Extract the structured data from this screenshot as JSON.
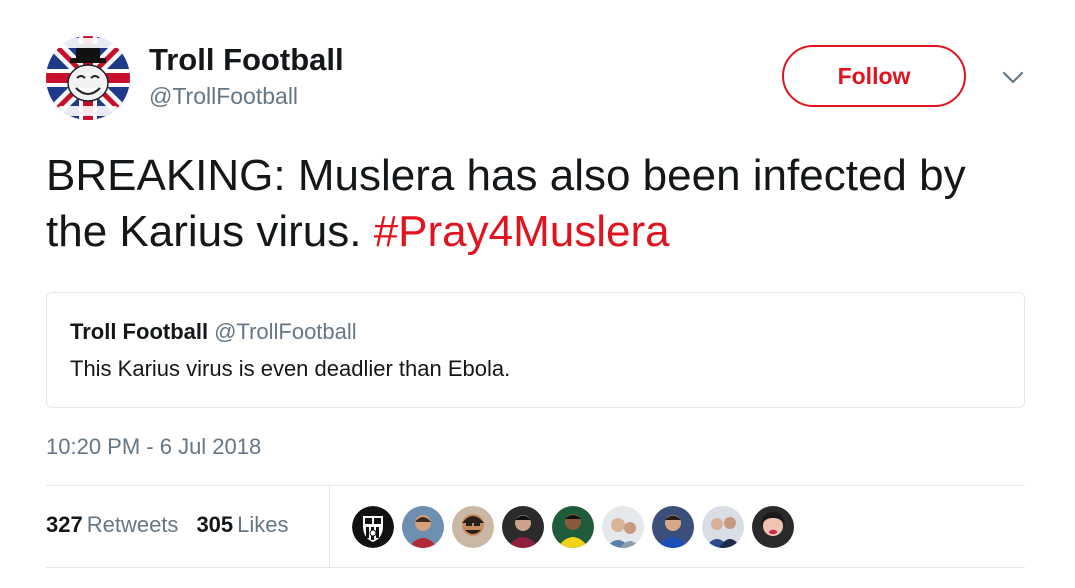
{
  "user": {
    "name": "Troll Football",
    "handle": "@TrollFootball",
    "avatar_icon": "troll-face-union-jack-icon"
  },
  "actions": {
    "follow_label": "Follow",
    "more_icon": "chevron-down-icon"
  },
  "tweet": {
    "text": "BREAKING: Muslera has also been infected by the Karius virus.",
    "hashtag": "#Pray4Muslera"
  },
  "quote": {
    "name": "Troll Football",
    "handle": "@TrollFootball",
    "text": "This Karius virus is even deadlier than Ebola."
  },
  "timestamp": "10:20 PM - 6 Jul 2018",
  "stats": {
    "retweets_count": "327",
    "retweets_label": "Retweets",
    "likes_count": "305",
    "likes_label": "Likes"
  },
  "colors": {
    "accent": "#e0141e",
    "text": "#14171a",
    "secondary_text": "#657786",
    "border": "#e1e8ed"
  },
  "likers": [
    {
      "icon": "fc-barcelona-crest-icon"
    },
    {
      "icon": "user-avatar-icon"
    },
    {
      "icon": "user-avatar-icon"
    },
    {
      "icon": "user-avatar-icon"
    },
    {
      "icon": "user-avatar-icon"
    },
    {
      "icon": "user-avatar-icon"
    },
    {
      "icon": "user-avatar-icon"
    },
    {
      "icon": "user-avatar-icon"
    },
    {
      "icon": "user-avatar-icon"
    }
  ]
}
